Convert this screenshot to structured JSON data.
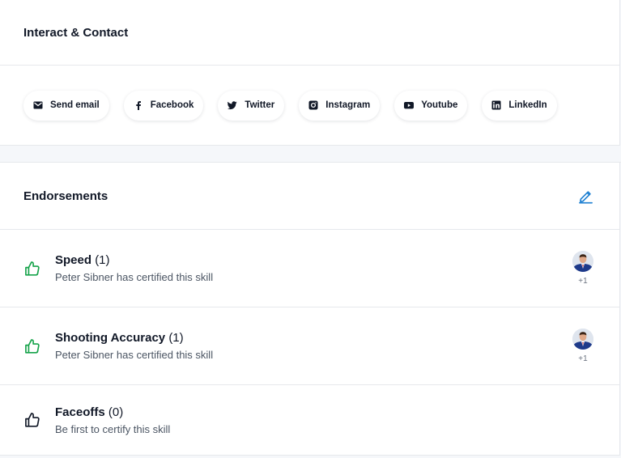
{
  "contact": {
    "title": "Interact & Contact",
    "buttons": [
      {
        "label": "Send email",
        "icon": "envelope-icon"
      },
      {
        "label": "Facebook",
        "icon": "facebook-icon"
      },
      {
        "label": "Twitter",
        "icon": "twitter-icon"
      },
      {
        "label": "Instagram",
        "icon": "instagram-icon"
      },
      {
        "label": "Youtube",
        "icon": "youtube-icon"
      },
      {
        "label": "LinkedIn",
        "icon": "linkedin-icon"
      }
    ]
  },
  "endorsements": {
    "title": "Endorsements",
    "items": [
      {
        "skill": "Speed",
        "count": "(1)",
        "subtitle": "Peter Sibner has certified this skill",
        "more": "+1",
        "certified": true
      },
      {
        "skill": "Shooting Accuracy",
        "count": "(1)",
        "subtitle": "Peter Sibner has certified this skill",
        "more": "+1",
        "certified": true
      },
      {
        "skill": "Faceoffs",
        "count": "(0)",
        "subtitle": "Be first to certify this skill",
        "certified": false
      }
    ]
  },
  "colors": {
    "accent": "#1d7fd1",
    "certified": "#16a34a",
    "text": "#111827",
    "muted": "#4b5563"
  }
}
